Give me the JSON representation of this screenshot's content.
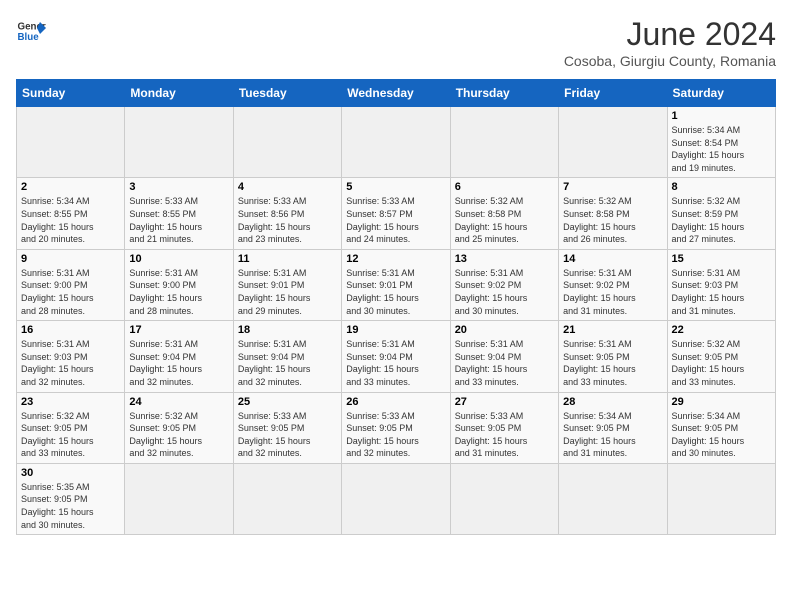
{
  "header": {
    "logo_general": "General",
    "logo_blue": "Blue",
    "title": "June 2024",
    "subtitle": "Cosoba, Giurgiu County, Romania"
  },
  "days_of_week": [
    "Sunday",
    "Monday",
    "Tuesday",
    "Wednesday",
    "Thursday",
    "Friday",
    "Saturday"
  ],
  "weeks": [
    [
      {
        "day": "",
        "info": ""
      },
      {
        "day": "",
        "info": ""
      },
      {
        "day": "",
        "info": ""
      },
      {
        "day": "",
        "info": ""
      },
      {
        "day": "",
        "info": ""
      },
      {
        "day": "",
        "info": ""
      },
      {
        "day": "1",
        "info": "Sunrise: 5:34 AM\nSunset: 8:54 PM\nDaylight: 15 hours\nand 19 minutes."
      }
    ],
    [
      {
        "day": "2",
        "info": "Sunrise: 5:34 AM\nSunset: 8:55 PM\nDaylight: 15 hours\nand 20 minutes."
      },
      {
        "day": "3",
        "info": "Sunrise: 5:33 AM\nSunset: 8:55 PM\nDaylight: 15 hours\nand 21 minutes."
      },
      {
        "day": "4",
        "info": "Sunrise: 5:33 AM\nSunset: 8:56 PM\nDaylight: 15 hours\nand 23 minutes."
      },
      {
        "day": "5",
        "info": "Sunrise: 5:33 AM\nSunset: 8:57 PM\nDaylight: 15 hours\nand 24 minutes."
      },
      {
        "day": "6",
        "info": "Sunrise: 5:32 AM\nSunset: 8:58 PM\nDaylight: 15 hours\nand 25 minutes."
      },
      {
        "day": "7",
        "info": "Sunrise: 5:32 AM\nSunset: 8:58 PM\nDaylight: 15 hours\nand 26 minutes."
      },
      {
        "day": "8",
        "info": "Sunrise: 5:32 AM\nSunset: 8:59 PM\nDaylight: 15 hours\nand 27 minutes."
      }
    ],
    [
      {
        "day": "9",
        "info": "Sunrise: 5:31 AM\nSunset: 9:00 PM\nDaylight: 15 hours\nand 28 minutes."
      },
      {
        "day": "10",
        "info": "Sunrise: 5:31 AM\nSunset: 9:00 PM\nDaylight: 15 hours\nand 28 minutes."
      },
      {
        "day": "11",
        "info": "Sunrise: 5:31 AM\nSunset: 9:01 PM\nDaylight: 15 hours\nand 29 minutes."
      },
      {
        "day": "12",
        "info": "Sunrise: 5:31 AM\nSunset: 9:01 PM\nDaylight: 15 hours\nand 30 minutes."
      },
      {
        "day": "13",
        "info": "Sunrise: 5:31 AM\nSunset: 9:02 PM\nDaylight: 15 hours\nand 30 minutes."
      },
      {
        "day": "14",
        "info": "Sunrise: 5:31 AM\nSunset: 9:02 PM\nDaylight: 15 hours\nand 31 minutes."
      },
      {
        "day": "15",
        "info": "Sunrise: 5:31 AM\nSunset: 9:03 PM\nDaylight: 15 hours\nand 31 minutes."
      }
    ],
    [
      {
        "day": "16",
        "info": "Sunrise: 5:31 AM\nSunset: 9:03 PM\nDaylight: 15 hours\nand 32 minutes."
      },
      {
        "day": "17",
        "info": "Sunrise: 5:31 AM\nSunset: 9:04 PM\nDaylight: 15 hours\nand 32 minutes."
      },
      {
        "day": "18",
        "info": "Sunrise: 5:31 AM\nSunset: 9:04 PM\nDaylight: 15 hours\nand 32 minutes."
      },
      {
        "day": "19",
        "info": "Sunrise: 5:31 AM\nSunset: 9:04 PM\nDaylight: 15 hours\nand 33 minutes."
      },
      {
        "day": "20",
        "info": "Sunrise: 5:31 AM\nSunset: 9:04 PM\nDaylight: 15 hours\nand 33 minutes."
      },
      {
        "day": "21",
        "info": "Sunrise: 5:31 AM\nSunset: 9:05 PM\nDaylight: 15 hours\nand 33 minutes."
      },
      {
        "day": "22",
        "info": "Sunrise: 5:32 AM\nSunset: 9:05 PM\nDaylight: 15 hours\nand 33 minutes."
      }
    ],
    [
      {
        "day": "23",
        "info": "Sunrise: 5:32 AM\nSunset: 9:05 PM\nDaylight: 15 hours\nand 33 minutes."
      },
      {
        "day": "24",
        "info": "Sunrise: 5:32 AM\nSunset: 9:05 PM\nDaylight: 15 hours\nand 32 minutes."
      },
      {
        "day": "25",
        "info": "Sunrise: 5:33 AM\nSunset: 9:05 PM\nDaylight: 15 hours\nand 32 minutes."
      },
      {
        "day": "26",
        "info": "Sunrise: 5:33 AM\nSunset: 9:05 PM\nDaylight: 15 hours\nand 32 minutes."
      },
      {
        "day": "27",
        "info": "Sunrise: 5:33 AM\nSunset: 9:05 PM\nDaylight: 15 hours\nand 31 minutes."
      },
      {
        "day": "28",
        "info": "Sunrise: 5:34 AM\nSunset: 9:05 PM\nDaylight: 15 hours\nand 31 minutes."
      },
      {
        "day": "29",
        "info": "Sunrise: 5:34 AM\nSunset: 9:05 PM\nDaylight: 15 hours\nand 30 minutes."
      }
    ],
    [
      {
        "day": "30",
        "info": "Sunrise: 5:35 AM\nSunset: 9:05 PM\nDaylight: 15 hours\nand 30 minutes."
      },
      {
        "day": "",
        "info": ""
      },
      {
        "day": "",
        "info": ""
      },
      {
        "day": "",
        "info": ""
      },
      {
        "day": "",
        "info": ""
      },
      {
        "day": "",
        "info": ""
      },
      {
        "day": "",
        "info": ""
      }
    ]
  ]
}
